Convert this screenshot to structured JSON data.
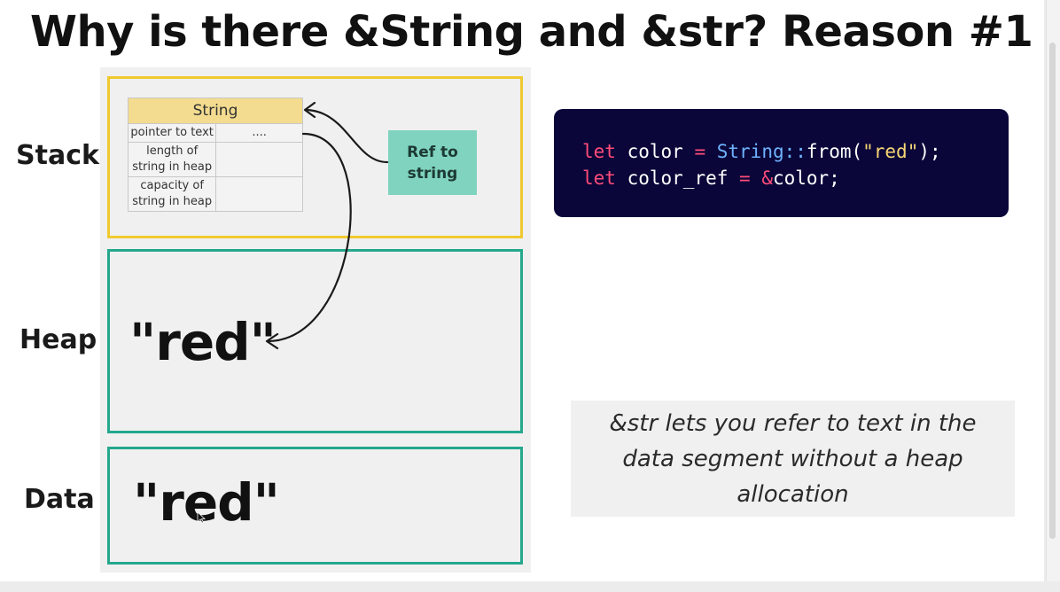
{
  "title": "Why is there &String and &str? Reason #1",
  "regions": {
    "stack": "Stack",
    "heap": "Heap",
    "data": "Data"
  },
  "string_table": {
    "header": "String",
    "rows": [
      {
        "field": "pointer to text",
        "value": "...."
      },
      {
        "field": "length of\nstring in heap",
        "value": ""
      },
      {
        "field": "capacity of\nstring in heap",
        "value": ""
      }
    ]
  },
  "ref_box": "Ref to\nstring",
  "heap_value": "\"red\"",
  "data_value": "\"red\"",
  "code": {
    "line1": {
      "kw": "let",
      "name": " color ",
      "op": "=",
      "type": " String::",
      "call": "from(",
      "str": "\"red\"",
      "end": ");"
    },
    "line2": {
      "kw": "let",
      "name": " color_ref ",
      "op": "=",
      "amp": " &",
      "rest": "color;"
    }
  },
  "note": "&str lets you refer to text in the data segment without a heap allocation",
  "colors": {
    "stack_border": "#f0c92f",
    "heap_border": "#24a88c",
    "data_border": "#24a88c",
    "string_header": "#f3dc8f",
    "ref_box": "#7fd3bf",
    "code_bg": "#0a0639",
    "keyword": "#ff4c7a",
    "type": "#6fb3ff",
    "string_literal": "#f7d774"
  },
  "icons": {
    "cursor": "mouse-cursor-icon"
  }
}
